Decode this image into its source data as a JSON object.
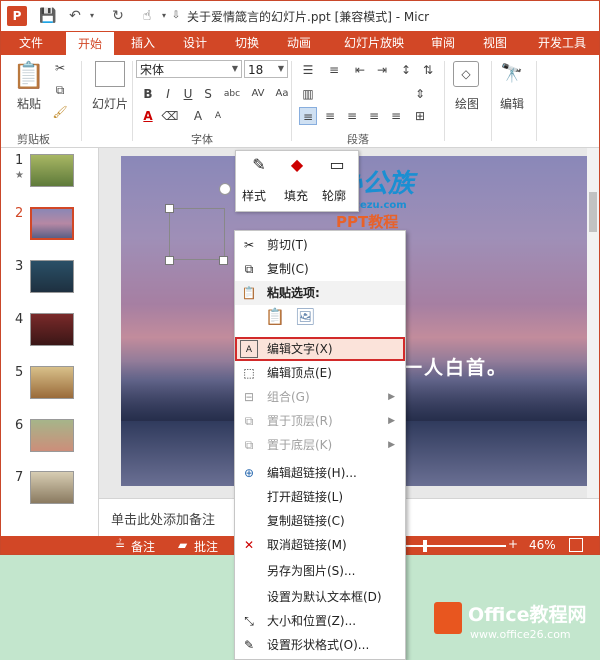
{
  "titlebar": {
    "app_icon": "P",
    "title": "关于爱情箴言的幻灯片.ppt [兼容模式] - Micr",
    "qat_icons": [
      "save-icon",
      "undo-icon",
      "redo-icon",
      "touch-mode-icon",
      "customize-icon"
    ]
  },
  "tabs": [
    "文件",
    "开始",
    "插入",
    "设计",
    "切换",
    "动画",
    "幻灯片放映",
    "审阅",
    "视图",
    "开发工具"
  ],
  "ribbon": {
    "clipboard": {
      "paste": "粘贴",
      "group": "剪贴板"
    },
    "slides": {
      "slide_btn": "幻灯片"
    },
    "font": {
      "name": "宋体",
      "size": "18",
      "group": "字体",
      "bold": "B",
      "italic": "I",
      "underline": "U",
      "strike": "S",
      "shadow": "abc",
      "color": "A",
      "size_up": "A",
      "size_down": "A",
      "spacing": "AV",
      "case": "Aa"
    },
    "paragraph": {
      "group": "段落"
    },
    "drawing": {
      "label": "绘图"
    },
    "editing": {
      "label": "编辑"
    }
  },
  "thumbnails": [
    {
      "num": "1",
      "star": "★"
    },
    {
      "num": "2"
    },
    {
      "num": "3"
    },
    {
      "num": "4"
    },
    {
      "num": "5"
    },
    {
      "num": "6"
    },
    {
      "num": "7"
    }
  ],
  "slide": {
    "text": "一人白首。"
  },
  "notes": {
    "placeholder": "单击此处添加备注"
  },
  "status": {
    "notes": "备注",
    "comments": "批注",
    "zoom": "46%"
  },
  "mini_toolbar": {
    "style": "样式",
    "fill": "填充",
    "outline": "轮廓"
  },
  "context_menu": [
    {
      "label": "剪切(T)",
      "icon": "cut-icon"
    },
    {
      "label": "复制(C)",
      "icon": "copy-icon"
    },
    {
      "label": "粘贴选项:",
      "icon": "paste-icon"
    },
    {
      "label": "编辑文字(X)",
      "icon": "edit-text-icon"
    },
    {
      "label": "编辑顶点(E)",
      "icon": "edit-points-icon"
    },
    {
      "label": "组合(G)",
      "icon": "group-icon"
    },
    {
      "label": "置于顶层(R)",
      "icon": "bring-front-icon"
    },
    {
      "label": "置于底层(K)",
      "icon": "send-back-icon"
    },
    {
      "label": "编辑超链接(H)...",
      "icon": "hyperlink-icon"
    },
    {
      "label": "打开超链接(L)",
      "icon": ""
    },
    {
      "label": "复制超链接(C)",
      "icon": ""
    },
    {
      "label": "取消超链接(M)",
      "icon": "remove-link-icon"
    },
    {
      "label": "另存为图片(S)...",
      "icon": ""
    },
    {
      "label": "设置为默认文本框(D)",
      "icon": ""
    },
    {
      "label": "大小和位置(Z)...",
      "icon": "size-icon"
    },
    {
      "label": "设置形状格式(O)...",
      "icon": "format-shape-icon"
    }
  ],
  "watermarks": {
    "top_brand": "办公族",
    "top_url": "officezu.com",
    "top_sub": "PPT教程",
    "bottom_brand": "Office教程网",
    "bottom_url": "www.office26.com"
  },
  "colors": {
    "accent": "#d24726",
    "highlight_border": "#d22a2a"
  }
}
